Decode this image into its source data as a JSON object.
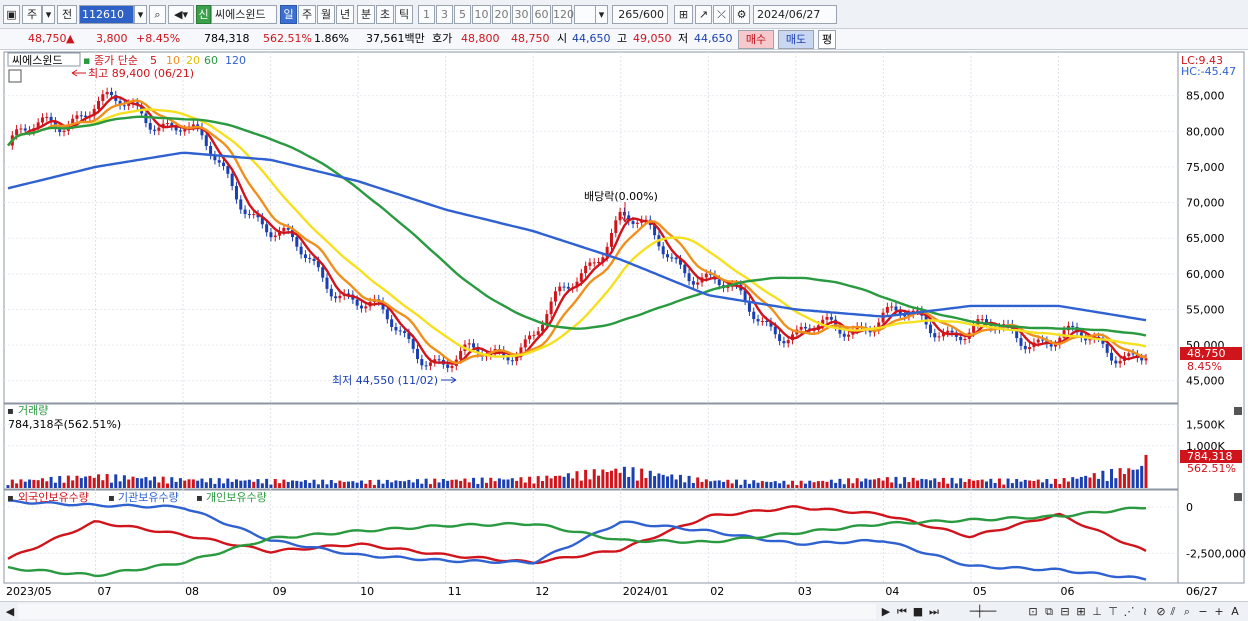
{
  "toolbar": {
    "period_day": "주",
    "prev": "전",
    "code": "112610",
    "new_badge": "신",
    "stock_name": "씨에스윈드",
    "period_tabs": [
      "일",
      "주",
      "월",
      "년",
      "분",
      "초",
      "틱"
    ],
    "period_selected": "일",
    "intervals": [
      "1",
      "3",
      "5",
      "10",
      "20",
      "30",
      "60",
      "120"
    ],
    "count": "265",
    "count_total": "/600",
    "date": "2024/06/27"
  },
  "quote": {
    "price": "48,750",
    "arrow": "▲",
    "change": "3,800",
    "change_pct": "+8.45%",
    "volume": "784,318",
    "volume_pct": "562.51%",
    "turnover_pct": "1.86%",
    "amount": "37,561백만",
    "bid_label": "호가",
    "ask_price": "48,800",
    "bid_price": "48,750",
    "open_label": "시",
    "open": "44,650",
    "high_label": "고",
    "high": "49,050",
    "low_label": "저",
    "low": "44,650",
    "buy": "매수",
    "sell": "매도",
    "eval": "평"
  },
  "price_panel": {
    "stock_tag": "씨에스윈드",
    "ma_label": "종가 단순",
    "ma_periods": [
      "5",
      "10",
      "20",
      "60",
      "120"
    ],
    "ma_colors": [
      "#d0141c",
      "#f0901c",
      "#f5e020",
      "#2a9a40",
      "#2f62d0"
    ],
    "hi_note": "최고 89,400 (06/21)",
    "lo_note": "최저 44,550 (11/02)",
    "div_note": "배당락(0.00%)",
    "lc": "LC:9.43",
    "hc": "HC:-45.47",
    "y_ticks": [
      "85,000",
      "80,000",
      "75,000",
      "70,000",
      "65,000",
      "60,000",
      "55,000",
      "50,000",
      "45,000"
    ],
    "last_price": "48,750",
    "last_pct": "8.45%"
  },
  "volume_panel": {
    "title": "거래량",
    "value": "784,318주(562.51%)",
    "y_ticks": [
      "1,500K",
      "1,000K"
    ],
    "last": "784,318",
    "last_pct": "562.51%"
  },
  "holder_panel": {
    "legend": [
      "외국인보유수량",
      "기관보유수량",
      "개인보유수량"
    ],
    "colors": [
      "#d0141c",
      "#2f62d0",
      "#2a9a40"
    ],
    "y_ticks": [
      "0",
      "-2,500,000"
    ]
  },
  "x_axis": [
    "2023/05",
    "07",
    "08",
    "09",
    "10",
    "11",
    "12",
    "2024/01",
    "02",
    "03",
    "04",
    "05",
    "06",
    "06/27"
  ],
  "chart_data": [
    {
      "type": "line",
      "title": "씨에스윈드",
      "ylim": [
        43000,
        90000
      ],
      "x": [
        "2023/05",
        "07",
        "08",
        "09",
        "10",
        "11",
        "12",
        "2024/01",
        "02",
        "03",
        "04",
        "05",
        "06",
        "06/27"
      ],
      "series": [
        {
          "name": "종가",
          "values": [
            78000,
            84000,
            81000,
            66000,
            56000,
            47000,
            51000,
            68000,
            59000,
            51000,
            54000,
            52000,
            51000,
            48750
          ]
        },
        {
          "name": "120",
          "values": [
            72000,
            75000,
            77000,
            76000,
            73000,
            69000,
            66000,
            62000,
            57000,
            55000,
            54000,
            55500,
            55500,
            53500
          ]
        }
      ]
    },
    {
      "type": "bar",
      "title": "거래량",
      "ylim": [
        0,
        1800000
      ],
      "x": [
        "2023/05",
        "07",
        "08",
        "09",
        "10",
        "11",
        "12",
        "2024/01",
        "02",
        "03",
        "04",
        "05",
        "06",
        "06/27"
      ],
      "series": [
        {
          "values": [
            250000,
            450000,
            320000,
            280000,
            240000,
            300000,
            350000,
            700000,
            280000,
            220000,
            350000,
            300000,
            280000,
            784318
          ]
        }
      ]
    },
    {
      "type": "line",
      "ylim": [
        -4000000,
        600000
      ],
      "x": [
        "2023/05",
        "07",
        "08",
        "09",
        "10",
        "11",
        "12",
        "2024/01",
        "02",
        "03",
        "04",
        "05",
        "06",
        "06/27"
      ],
      "series": [
        {
          "name": "외국인보유수량",
          "values": [
            -2800000,
            -800000,
            -1500000,
            -2400000,
            -2000000,
            -2600000,
            -3000000,
            -2300000,
            -500000,
            0,
            -400000,
            -1600000,
            -400000,
            -2400000
          ]
        },
        {
          "name": "기관보유수량",
          "values": [
            300000,
            100000,
            0,
            -1800000,
            -2600000,
            -2900000,
            -3000000,
            -800000,
            -1300000,
            -2000000,
            -1800000,
            -3200000,
            -3400000,
            -3900000
          ]
        },
        {
          "name": "개인보유수량",
          "values": [
            -3300000,
            -3700000,
            -3000000,
            -1700000,
            -1300000,
            -1000000,
            -900000,
            -1800000,
            -1900000,
            -1400000,
            -900000,
            -700000,
            -500000,
            0
          ]
        }
      ]
    }
  ]
}
